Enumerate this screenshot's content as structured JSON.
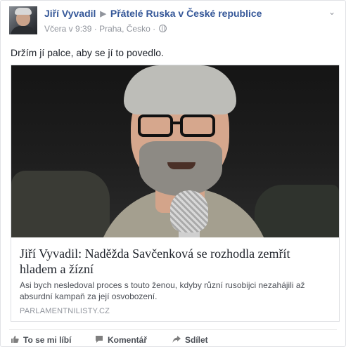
{
  "post": {
    "author": "Jiří Vyvadil",
    "group": "Přátelé Ruska v České republice",
    "time": "Včera v 9:39",
    "separator": "·",
    "location": "Praha, Česko",
    "location_separator": "·",
    "text": "Držím jí palce, aby se jí to povedlo."
  },
  "link": {
    "title": "Jiří Vyvadil: Naděžda Savčenková se rozhodla zemřít hladem a žízní",
    "description": "Asi bych nesledoval proces s touto ženou, kdyby různí rusobijci nezahájili až absurdní kampaň za její osvobození.",
    "domain": "PARLAMENTNILISTY.CZ"
  },
  "actions": {
    "like": "To se mi líbí",
    "comment": "Komentář",
    "share": "Sdílet"
  },
  "colors": {
    "link_blue": "#365899",
    "meta_gray": "#90949c",
    "text": "#1d2129"
  }
}
